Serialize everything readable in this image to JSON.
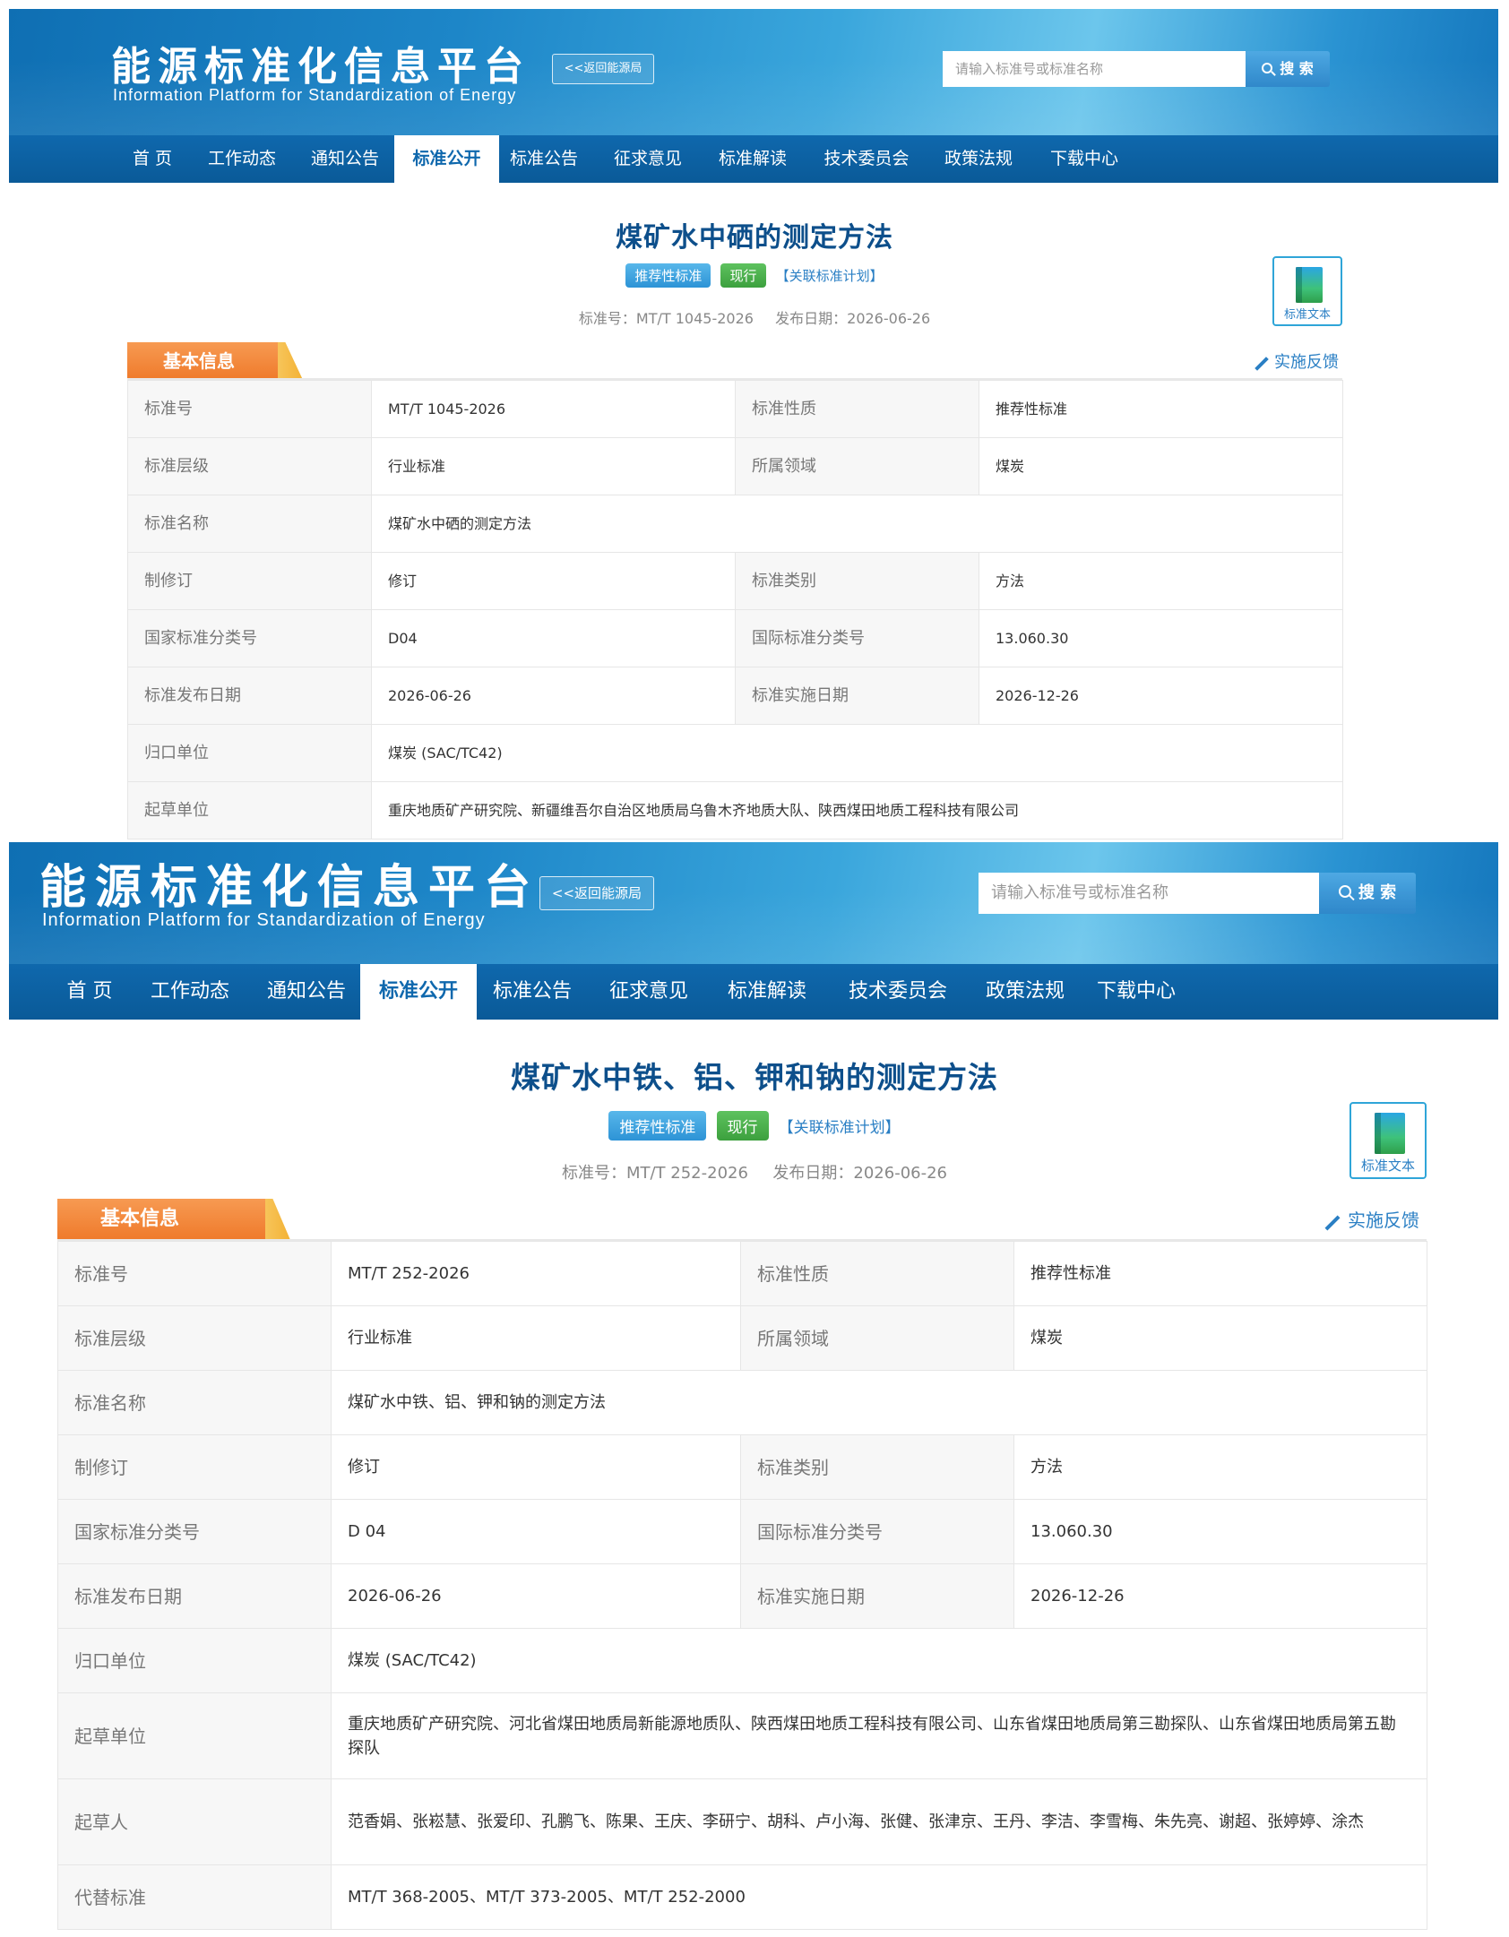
{
  "header": {
    "logo_cn": "能源标准化信息平台",
    "logo_en": "Information Platform for Standardization of Energy",
    "back_button": "<<返回能源局",
    "search_placeholder": "请输入标准号或标准名称",
    "search_button": "搜 索"
  },
  "nav": {
    "items": [
      "首 页",
      "工作动态",
      "通知公告",
      "标准公开",
      "标准公告",
      "征求意见",
      "标准解读",
      "技术委员会",
      "政策法规",
      "下载中心"
    ],
    "active": "标准公开"
  },
  "common": {
    "tag_recommended": "推荐性标准",
    "tag_current": "现行",
    "tag_link": "【关联标准计划】",
    "std_doc_label": "标准文本",
    "section_label": "基本信息",
    "feedback": "实施反馈",
    "meta_no_label": "标准号：",
    "meta_date_label": "发布日期："
  },
  "page1": {
    "title": "煤矿水中硒的测定方法",
    "std_no": "MT/T 1045-2026",
    "pub_date": "2026-06-26",
    "rows": [
      [
        "标准号",
        "MT/T 1045-2026",
        "标准性质",
        "推荐性标准"
      ],
      [
        "标准层级",
        "行业标准",
        "所属领域",
        "煤炭"
      ],
      [
        "标准名称",
        "煤矿水中硒的测定方法"
      ],
      [
        "制修订",
        "修订",
        "标准类别",
        "方法"
      ],
      [
        "国家标准分类号",
        "D04",
        "国际标准分类号",
        "13.060.30"
      ],
      [
        "标准发布日期",
        "2026-06-26",
        "标准实施日期",
        "2026-12-26"
      ],
      [
        "归口单位",
        "煤炭 (SAC/TC42)"
      ],
      [
        "起草单位",
        "重庆地质矿产研究院、新疆维吾尔自治区地质局乌鲁木齐地质大队、陕西煤田地质工程科技有限公司"
      ]
    ]
  },
  "page2": {
    "title": "煤矿水中铁、铝、钾和钠的测定方法",
    "std_no": "MT/T 252-2026",
    "pub_date": "2026-06-26",
    "rows": [
      [
        "标准号",
        "MT/T 252-2026",
        "标准性质",
        "推荐性标准"
      ],
      [
        "标准层级",
        "行业标准",
        "所属领域",
        "煤炭"
      ],
      [
        "标准名称",
        "煤矿水中铁、铝、钾和钠的测定方法"
      ],
      [
        "制修订",
        "修订",
        "标准类别",
        "方法"
      ],
      [
        "国家标准分类号",
        "D 04",
        "国际标准分类号",
        "13.060.30"
      ],
      [
        "标准发布日期",
        "2026-06-26",
        "标准实施日期",
        "2026-12-26"
      ],
      [
        "归口单位",
        "煤炭 (SAC/TC42)"
      ],
      [
        "起草单位",
        "重庆地质矿产研究院、河北省煤田地质局新能源地质队、陕西煤田地质工程科技有限公司、山东省煤田地质局第三勘探队、山东省煤田地质局第五勘探队"
      ],
      [
        "起草人",
        "范香娟、张崧慧、张爱印、孔鹏飞、陈果、王庆、李研宁、胡科、卢小海、张健、张津京、王丹、李洁、李雪梅、朱先亮、谢超、张婷婷、涂杰"
      ],
      [
        "代替标准",
        "MT/T 368-2005、MT/T 373-2005、MT/T 252-2000"
      ]
    ]
  }
}
